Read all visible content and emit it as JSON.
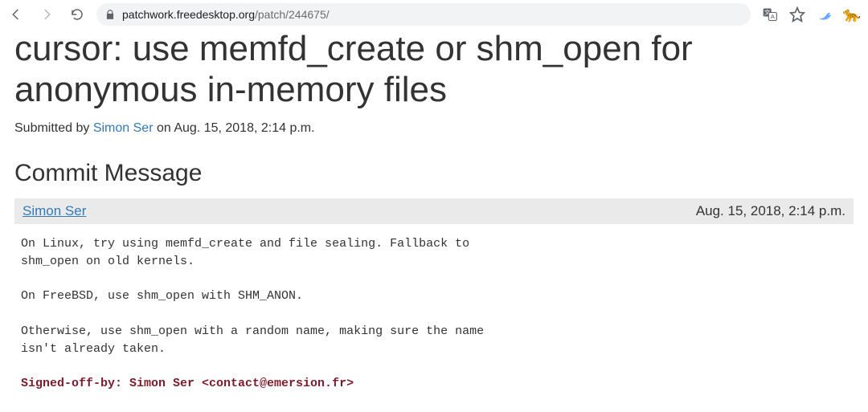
{
  "browser": {
    "url_host": "patchwork.freedesktop.org",
    "url_path": "/patch/244675/"
  },
  "page": {
    "title": "cursor: use memfd_create or shm_open for anonymous in-memory files",
    "submitted_prefix": "Submitted by ",
    "submitted_author": "Simon Ser",
    "submitted_suffix": " on Aug. 15, 2018, 2:14 p.m.",
    "section_heading": "Commit Message",
    "message_header": {
      "author": "Simon Ser",
      "date": "Aug. 15, 2018, 2:14 p.m."
    },
    "commit_body": "On Linux, try using memfd_create and file sealing. Fallback to\nshm_open on old kernels.\n\nOn FreeBSD, use shm_open with SHM_ANON.\n\nOtherwise, use shm_open with a random name, making sure the name\nisn't already taken.",
    "signed_off": "Signed-off-by: Simon Ser <contact@emersion.fr>"
  }
}
